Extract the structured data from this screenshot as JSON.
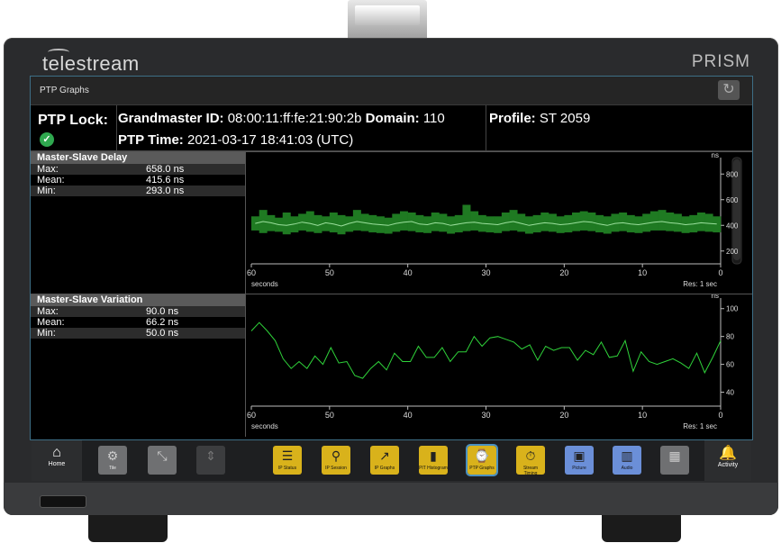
{
  "brand": "telestream",
  "product": "PRISM",
  "window_title": "PTP Graphs",
  "ptp_lock_label": "PTP Lock:",
  "grandmaster_label": "Grandmaster ID:",
  "grandmaster_value": "08:00:11:ff:fe:21:90:2b",
  "domain_label": "Domain:",
  "domain_value": "110",
  "profile_label": "Profile:",
  "profile_value": "ST 2059",
  "ptp_time_label": "PTP Time:",
  "ptp_time_value": "2021-03-17 18:41:03 (UTC)",
  "panels": [
    {
      "title": "Master-Slave Delay",
      "stats": [
        {
          "label": "Max:",
          "value": "658.0 ns"
        },
        {
          "label": "Mean:",
          "value": "415.6 ns"
        },
        {
          "label": "Min:",
          "value": "293.0 ns"
        }
      ],
      "unit": "ns",
      "y_ticks": [
        "800",
        "600",
        "400",
        "200"
      ],
      "x_ticks": [
        "60",
        "50",
        "40",
        "30",
        "20",
        "10",
        "0"
      ],
      "x_label": "seconds",
      "res": "Res: 1 sec"
    },
    {
      "title": "Master-Slave Variation",
      "stats": [
        {
          "label": "Max:",
          "value": "90.0 ns"
        },
        {
          "label": "Mean:",
          "value": "66.2 ns"
        },
        {
          "label": "Min:",
          "value": "50.0 ns"
        }
      ],
      "unit": "ns",
      "y_ticks": [
        "100",
        "80",
        "60",
        "40"
      ],
      "x_ticks": [
        "60",
        "50",
        "40",
        "30",
        "20",
        "10",
        "0"
      ],
      "x_label": "seconds",
      "res": "Res: 1 sec"
    }
  ],
  "chart_data": [
    {
      "type": "area",
      "ylabel": "ns",
      "xlabel": "seconds",
      "xlim": [
        60,
        0
      ],
      "ylim": [
        100,
        900
      ],
      "series": [
        {
          "values": [
            415,
            430,
            420,
            405,
            400,
            410,
            425,
            415,
            400,
            420,
            410,
            395,
            415,
            430,
            420,
            410,
            405,
            400,
            415,
            425,
            430,
            410,
            405,
            420,
            415,
            400,
            410,
            420,
            425,
            415,
            410,
            405,
            420,
            430,
            415,
            400,
            410,
            420,
            415,
            405,
            410,
            420,
            430,
            425,
            410,
            400,
            415,
            420,
            410,
            405,
            415,
            425,
            430,
            420,
            415,
            405,
            410,
            420,
            415,
            410
          ]
        },
        {
          "values": [
            470,
            520,
            480,
            460,
            500,
            470,
            490,
            510,
            480,
            470,
            500,
            480,
            470,
            520,
            490,
            480,
            470,
            460,
            490,
            510,
            500,
            480,
            470,
            500,
            490,
            470,
            480,
            560,
            510,
            480,
            470,
            470,
            500,
            520,
            490,
            470,
            480,
            500,
            490,
            470,
            480,
            500,
            510,
            500,
            480,
            470,
            490,
            500,
            480,
            470,
            490,
            510,
            520,
            500,
            490,
            470,
            480,
            500,
            490,
            470
          ]
        },
        {
          "values": [
            360,
            340,
            355,
            350,
            330,
            345,
            360,
            350,
            340,
            355,
            345,
            330,
            350,
            360,
            355,
            345,
            340,
            335,
            350,
            360,
            355,
            345,
            340,
            355,
            350,
            335,
            345,
            355,
            360,
            350,
            345,
            340,
            355,
            360,
            350,
            335,
            345,
            355,
            350,
            340,
            345,
            355,
            360,
            355,
            345,
            335,
            350,
            355,
            345,
            340,
            350,
            360,
            360,
            355,
            350,
            340,
            345,
            355,
            350,
            345
          ]
        }
      ]
    },
    {
      "type": "line",
      "ylabel": "ns",
      "xlabel": "seconds",
      "xlim": [
        60,
        0
      ],
      "ylim": [
        30,
        105
      ],
      "series": [
        {
          "values": [
            84,
            90,
            84,
            77,
            64,
            57,
            62,
            57,
            66,
            60,
            72,
            61,
            62,
            52,
            50,
            57,
            62,
            56,
            68,
            62,
            62,
            73,
            65,
            65,
            72,
            62,
            69,
            69,
            80,
            73,
            79,
            80,
            78,
            76,
            71,
            74,
            63,
            73,
            70,
            72,
            72,
            63,
            70,
            67,
            76,
            65,
            66,
            77,
            55,
            69,
            62,
            60,
            62,
            64,
            61,
            57,
            68,
            54,
            65,
            77
          ]
        }
      ]
    }
  ],
  "dock": {
    "home": "Home",
    "tile": "Tile",
    "apps": [
      "IP Status",
      "IP Session",
      "IP Graphs",
      "PIT Histogram",
      "PTP Graphs",
      "Stream Timing",
      "Picture",
      "Audio"
    ],
    "activity": "Activity"
  }
}
